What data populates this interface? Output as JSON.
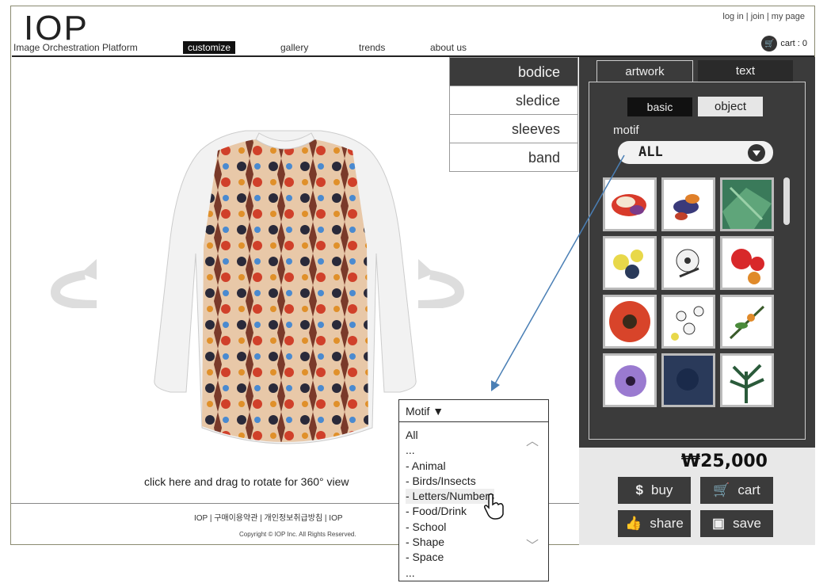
{
  "header": {
    "logo": "IOP",
    "logo_sub": "Image Orchestration Platform",
    "nav": [
      "customize",
      "gallery",
      "trends",
      "about us"
    ],
    "user_links": [
      "log in",
      "join",
      "my page"
    ],
    "cart_label": "cart : 0"
  },
  "parts": [
    "bodice",
    "sledice",
    "sleeves",
    "band"
  ],
  "panel": {
    "tabs": [
      "artwork",
      "text"
    ],
    "subtabs": [
      "basic",
      "object"
    ],
    "motif_label": "motif",
    "motif_value": "ALL"
  },
  "purchase": {
    "price": "₩25,000",
    "buttons": {
      "buy": "buy",
      "cart": "cart",
      "share": "share",
      "save": "save"
    },
    "icons": {
      "buy": "$",
      "save": "▣"
    }
  },
  "viewer": {
    "hint": "click here and drag to rotate for 360° view"
  },
  "footer": {
    "links": "IOP  |  구매이용약관  |  개인정보취급방침  |  IOP",
    "copyright": "Copyright © IOP Inc. All Rights Reserved."
  },
  "motif_popup": {
    "title": "Motif ▼",
    "items": [
      "All",
      "...",
      "- Animal",
      "- Birds/Insects",
      "- Letters/Numbers",
      "- Food/Drink",
      "- School",
      "- Shape",
      "- Space",
      "..."
    ]
  },
  "colors": {
    "panel": "#3b3b3b",
    "accent": "#4a7fb5"
  }
}
